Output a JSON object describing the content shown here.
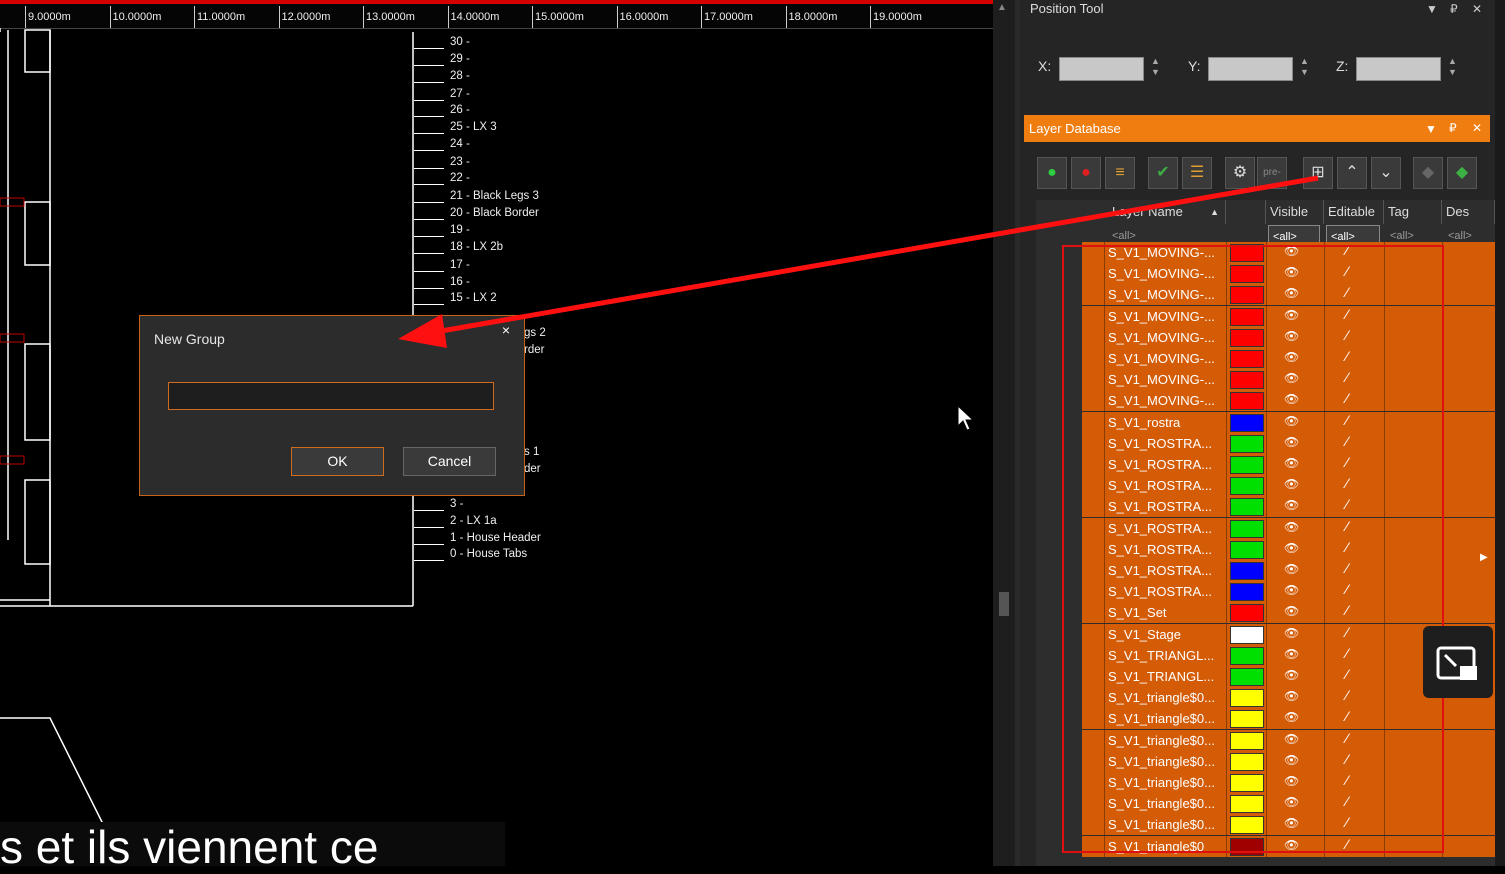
{
  "ruler": {
    "ticks": [
      "9.0000m",
      "10.0000m",
      "11.0000m",
      "12.0000m",
      "13.0000m",
      "14.0000m",
      "15.0000m",
      "16.0000m",
      "17.0000m",
      "18.0000m",
      "19.0000m"
    ]
  },
  "levels": [
    "30 -",
    "29 -",
    "28 -",
    "27 -",
    "26 -",
    "25 - LX 3",
    "24 -",
    "23 -",
    "22 -",
    "21 - Black Legs 3",
    "20 - Black Border",
    "19 -",
    "18 - LX 2b",
    "17 -",
    "16 -",
    "15 - LX 2"
  ],
  "levels_partial_right": [
    "gs 2",
    "rder",
    "s 1",
    "der"
  ],
  "levels_bottom": [
    "3 -",
    "2 - LX 1a",
    "1 - House Header",
    "0 - House Tabs"
  ],
  "dialog": {
    "title": "New Group",
    "close": "×",
    "input_value": "",
    "ok": "OK",
    "cancel": "Cancel"
  },
  "position_tool": {
    "title": "Position Tool",
    "x_label": "X:",
    "y_label": "Y:",
    "z_label": "Z:",
    "x_value": "",
    "y_value": "",
    "z_value": ""
  },
  "layer_db": {
    "title": "Layer Database",
    "columns": [
      "Layer Name",
      "Visible",
      "Editable",
      "Tag",
      "Des"
    ],
    "filters": {
      "name": "<all>",
      "visible": "<all>",
      "editable": "<all>",
      "tag": "<all>",
      "des": "<all>"
    },
    "toolbar_pre": "pre-",
    "rows": [
      {
        "name": "S_V1_MOVING-...",
        "color": "#ff0000"
      },
      {
        "name": "S_V1_MOVING-...",
        "color": "#ff0000"
      },
      {
        "name": "S_V1_MOVING-...",
        "color": "#ff0000"
      },
      {
        "name": "S_V1_MOVING-...",
        "color": "#ff0000"
      },
      {
        "name": "S_V1_MOVING-...",
        "color": "#ff0000"
      },
      {
        "name": "S_V1_MOVING-...",
        "color": "#ff0000"
      },
      {
        "name": "S_V1_MOVING-...",
        "color": "#ff0000"
      },
      {
        "name": "S_V1_MOVING-...",
        "color": "#ff0000"
      },
      {
        "name": "S_V1_rostra",
        "color": "#0000ff"
      },
      {
        "name": "S_V1_ROSTRA...",
        "color": "#00e000"
      },
      {
        "name": "S_V1_ROSTRA...",
        "color": "#00e000"
      },
      {
        "name": "S_V1_ROSTRA...",
        "color": "#00e000"
      },
      {
        "name": "S_V1_ROSTRA...",
        "color": "#00e000"
      },
      {
        "name": "S_V1_ROSTRA...",
        "color": "#00e000"
      },
      {
        "name": "S_V1_ROSTRA...",
        "color": "#00e000"
      },
      {
        "name": "S_V1_ROSTRA...",
        "color": "#0000ff"
      },
      {
        "name": "S_V1_ROSTRA...",
        "color": "#0000ff"
      },
      {
        "name": "S_V1_Set",
        "color": "#ff0000"
      },
      {
        "name": "S_V1_Stage",
        "color": "#ffffff"
      },
      {
        "name": "S_V1_TRIANGL...",
        "color": "#00e000"
      },
      {
        "name": "S_V1_TRIANGL...",
        "color": "#00e000"
      },
      {
        "name": "S_V1_triangle$0...",
        "color": "#ffff00"
      },
      {
        "name": "S_V1_triangle$0...",
        "color": "#ffff00"
      },
      {
        "name": "S_V1_triangle$0...",
        "color": "#ffff00"
      },
      {
        "name": "S_V1_triangle$0...",
        "color": "#ffff00"
      },
      {
        "name": "S_V1_triangle$0...",
        "color": "#ffff00"
      },
      {
        "name": "S_V1_triangle$0...",
        "color": "#ffff00"
      },
      {
        "name": "S_V1_triangle$0...",
        "color": "#ffff00"
      },
      {
        "name": "S_V1_triangle$0",
        "color": "#a00000"
      }
    ]
  },
  "subtitle": "s et ils viennent ce",
  "colors": {
    "accent": "#f07d10",
    "row_bg": "#d55c07",
    "annotation": "#e01010"
  }
}
